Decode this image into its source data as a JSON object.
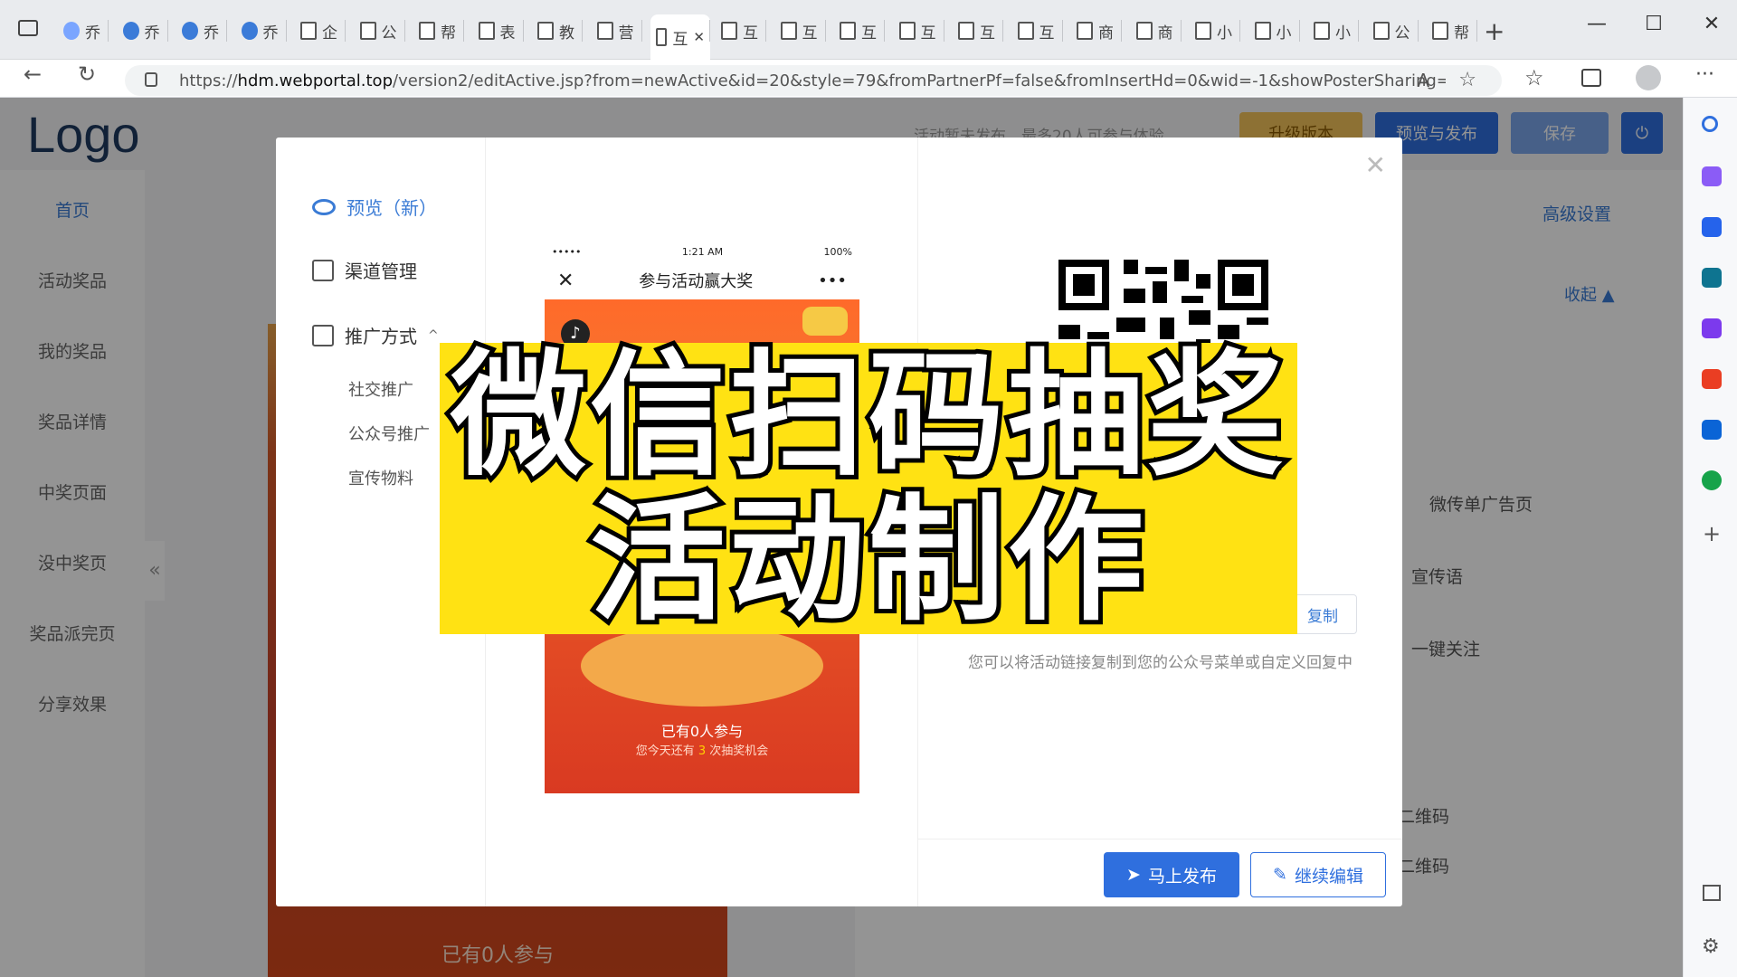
{
  "browser": {
    "tabs": [
      {
        "label": "乔",
        "icon": "paw-icon"
      },
      {
        "label": "乔",
        "icon": "n-icon"
      },
      {
        "label": "乔",
        "icon": "n-icon"
      },
      {
        "label": "乔",
        "icon": "n-icon"
      },
      {
        "label": "企",
        "icon": "page-icon"
      },
      {
        "label": "公",
        "icon": "page-icon"
      },
      {
        "label": "帮",
        "icon": "page-icon"
      },
      {
        "label": "表",
        "icon": "page-icon"
      },
      {
        "label": "教",
        "icon": "page-icon"
      },
      {
        "label": "营",
        "icon": "page-icon"
      },
      {
        "label": "互",
        "icon": "page-icon",
        "active": true
      },
      {
        "label": "互",
        "icon": "page-icon"
      },
      {
        "label": "互",
        "icon": "page-icon"
      },
      {
        "label": "互",
        "icon": "page-icon"
      },
      {
        "label": "互",
        "icon": "page-icon"
      },
      {
        "label": "互",
        "icon": "page-icon"
      },
      {
        "label": "互",
        "icon": "page-icon"
      },
      {
        "label": "商",
        "icon": "page-icon"
      },
      {
        "label": "商",
        "icon": "page-icon"
      },
      {
        "label": "小",
        "icon": "page-icon"
      },
      {
        "label": "小",
        "icon": "page-icon"
      },
      {
        "label": "小",
        "icon": "page-icon"
      },
      {
        "label": "公",
        "icon": "page-icon"
      },
      {
        "label": "帮",
        "icon": "page-icon"
      }
    ],
    "url_prefix": "https://",
    "url_host": "hdm.webportal.top",
    "url_path": "/version2/editActive.jsp?from=newActive&id=20&style=79&fromPartnerPf=false&fromInsertHd=0&wid=-1&showPosterSharing=true..."
  },
  "app": {
    "logo": "Logo",
    "header_notice": "活动暂未发布，最多20人可参与体验",
    "upgrade_label": "升级版本",
    "preview_publish_label": "预览与发布",
    "save_label": "保存",
    "advanced_label": "高级设置",
    "collapse_label": "收起 ▲",
    "right_rows": [
      "微传单广告页",
      "宣传语",
      "一键关注",
      "二维码",
      "二维码"
    ],
    "nav": [
      "首页",
      "活动奖品",
      "我的奖品",
      "奖品详情",
      "中奖页面",
      "没中奖页",
      "奖品派完页",
      "分享效果"
    ],
    "bg_participants": "已有0人参与"
  },
  "modal": {
    "menu": {
      "preview": "预览（新）",
      "channel": "渠道管理",
      "promo": "推广方式",
      "sub": [
        "社交推广",
        "公众号推广",
        "宣传物料"
      ]
    },
    "phone": {
      "carrier": "•••••",
      "time": "1:21 AM",
      "battery": "100%",
      "title": "参与活动赢大奖",
      "more": "•••",
      "participants": "已有0人参与",
      "chances_prefix": "您今天还有",
      "chances_num": "3",
      "chances_suffix": "次抽奖机会"
    },
    "copy_label": "复制",
    "hint": "您可以将活动链接复制到您的公众号菜单或自定义回复中",
    "publish_label": "马上发布",
    "edit_label": "继续编辑"
  },
  "banner": {
    "line1": "微信扫码抽奖",
    "line2": "活动制作"
  }
}
